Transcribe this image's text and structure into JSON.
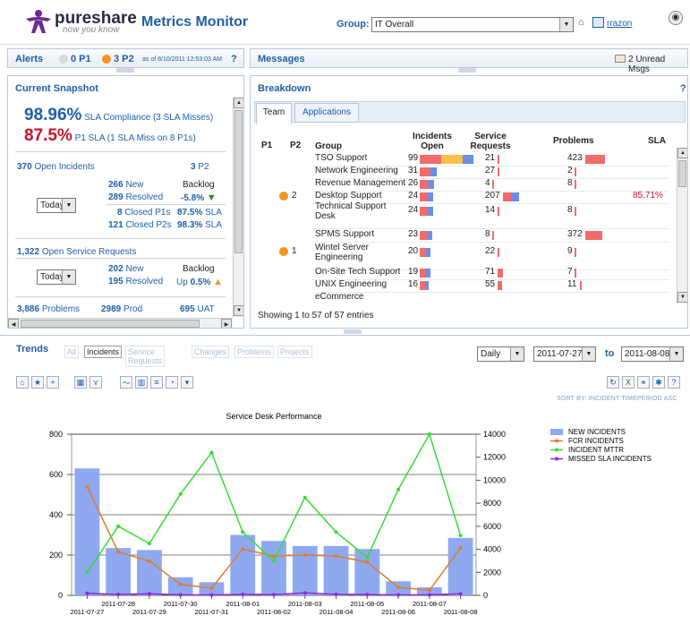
{
  "header": {
    "logo_text": "pureshare",
    "logo_tagline": "now you know",
    "app_title": "Metrics Monitor",
    "group_label": "Group:",
    "group_value": "IT Overall",
    "user": "rrazon"
  },
  "alerts": {
    "title": "Alerts",
    "p1": "0 P1",
    "p2": "3 P2",
    "timestamp": "as of 8/10/2011 12:53:03 AM",
    "help": "?"
  },
  "messages": {
    "title": "Messages",
    "unread": "2 Unread Msgs"
  },
  "snapshot": {
    "title": "Current Snapshot",
    "sla_pct": "98.96%",
    "sla_text": "SLA Compliance (3 SLA Misses)",
    "p1sla_pct": "87.5%",
    "p1sla_text": "P1 SLA (1 SLA Miss on 8 P1s)",
    "open_incidents_count": "370",
    "open_incidents_label": "Open Incidents",
    "p2_count": "3",
    "p2_label": "P2",
    "period1": "Today",
    "inc_new_count": "266",
    "inc_new_label": "New",
    "inc_resolved_count": "289",
    "inc_resolved_label": "Resolved",
    "backlog_label": "Backlog",
    "backlog_value": "-5.8%",
    "closed_p1_count": "8",
    "closed_p1_label": "Closed P1s",
    "closed_p1_sla": "87.5%",
    "closed_p2_count": "121",
    "closed_p2_label": "Closed P2s",
    "closed_p2_sla": "98.3%",
    "sla_label": "SLA",
    "open_sr_count": "1,322",
    "open_sr_label": "Open Service Requests",
    "period2": "Today",
    "sr_new_count": "202",
    "sr_new_label": "New",
    "sr_resolved_count": "195",
    "sr_resolved_label": "Resolved",
    "sr_backlog_label": "Backlog",
    "sr_backlog_prefix": "Up",
    "sr_backlog_value": "0.5%",
    "problems_count": "3,886",
    "problems_label": "Problems",
    "prod_count": "2989",
    "prod_label": "Prod",
    "uat_count": "695",
    "uat_label": "UAT"
  },
  "breakdown": {
    "title": "Breakdown",
    "help": "?",
    "tabs": [
      "Team",
      "Applications"
    ],
    "columns": [
      "P1",
      "P2",
      "Group",
      "Incidents Open",
      "Service Requests",
      "Problems",
      "SLA"
    ],
    "rows": [
      {
        "p1": "",
        "p2": "",
        "group": "TSO Support",
        "inc": "99",
        "sr": "21",
        "prob": "423",
        "sla": ""
      },
      {
        "p1": "",
        "p2": "",
        "group": "Network Engineering",
        "inc": "31",
        "sr": "27",
        "prob": "2",
        "sla": ""
      },
      {
        "p1": "",
        "p2": "",
        "group": "Revenue Management",
        "inc": "26",
        "sr": "4",
        "prob": "8",
        "sla": ""
      },
      {
        "p1": "",
        "p2": "2",
        "group": "Desktop Support",
        "inc": "24",
        "sr": "207",
        "prob": "",
        "sla": "85.71%"
      },
      {
        "p1": "",
        "p2": "",
        "group": "Technical Support Desk",
        "inc": "24",
        "sr": "14",
        "prob": "8",
        "sla": ""
      },
      {
        "p1": "",
        "p2": "",
        "group": "SPMS Support",
        "inc": "23",
        "sr": "8",
        "prob": "372",
        "sla": ""
      },
      {
        "p1": "",
        "p2": "1",
        "group": "Wintel Server Engineering",
        "inc": "20",
        "sr": "22",
        "prob": "9",
        "sla": ""
      },
      {
        "p1": "",
        "p2": "",
        "group": "On-Site Tech Support",
        "inc": "19",
        "sr": "71",
        "prob": "7",
        "sla": ""
      },
      {
        "p1": "",
        "p2": "",
        "group": "UNIX Engineering",
        "inc": "16",
        "sr": "55",
        "prob": "11",
        "sla": ""
      },
      {
        "p1": "",
        "p2": "",
        "group": "eCommerce",
        "inc": "",
        "sr": "",
        "prob": "",
        "sla": ""
      }
    ],
    "footer": "Showing 1 to 57 of 57 entries"
  },
  "trends": {
    "title": "Trends",
    "tabs": [
      "All",
      "Incidents",
      "Service Requests",
      "Changes",
      "Problems",
      "Projects"
    ],
    "active_tab": "Incidents",
    "granularity": "Daily",
    "date_from": "2011-07-27",
    "to_label": "to",
    "date_to": "2011-08-08",
    "sort_label": "SORT BY: INCIDENT TIMEPERIOD  ASC"
  },
  "colors": {
    "bar": "#8ea9f0",
    "fcr": "#e07b2e",
    "mttr": "#33dd33",
    "missed": "#8a2be2",
    "accent": "#1f5fa8"
  },
  "chart_data": {
    "type": "bar",
    "title": "Service Desk Performance",
    "categories": [
      "2011-07-27",
      "2011-07-28",
      "2011-07-29",
      "2011-07-30",
      "2011-07-31",
      "2011-08-01",
      "2011-08-02",
      "2011-08-03",
      "2011-08-04",
      "2011-08-05",
      "2011-08-06",
      "2011-08-07",
      "2011-08-08"
    ],
    "series": [
      {
        "name": "NEW INCIDENTS",
        "type": "bar",
        "axis": "left",
        "values": [
          630,
          235,
          225,
          90,
          65,
          300,
          270,
          245,
          245,
          230,
          70,
          40,
          285
        ]
      },
      {
        "name": "FCR INCIDENTS",
        "type": "line",
        "axis": "left",
        "values": [
          540,
          215,
          170,
          55,
          35,
          230,
          195,
          200,
          195,
          165,
          40,
          25,
          235
        ]
      },
      {
        "name": "INCIDENT MTTR",
        "type": "line",
        "axis": "right",
        "values": [
          2000,
          6000,
          4500,
          8800,
          12400,
          5500,
          3000,
          8500,
          5500,
          3300,
          9200,
          14000,
          5200
        ]
      },
      {
        "name": "MISSED SLA INCIDENTS",
        "type": "line",
        "axis": "left",
        "values": [
          10,
          5,
          8,
          3,
          2,
          5,
          4,
          12,
          5,
          4,
          2,
          3,
          8
        ]
      }
    ],
    "ylim": [
      0,
      800
    ],
    "y2lim": [
      0,
      14000
    ],
    "yticks": [
      0,
      200,
      400,
      600,
      800
    ],
    "y2ticks": [
      0,
      2000,
      4000,
      6000,
      8000,
      10000,
      12000,
      14000
    ],
    "legend": "right",
    "grid": true
  }
}
